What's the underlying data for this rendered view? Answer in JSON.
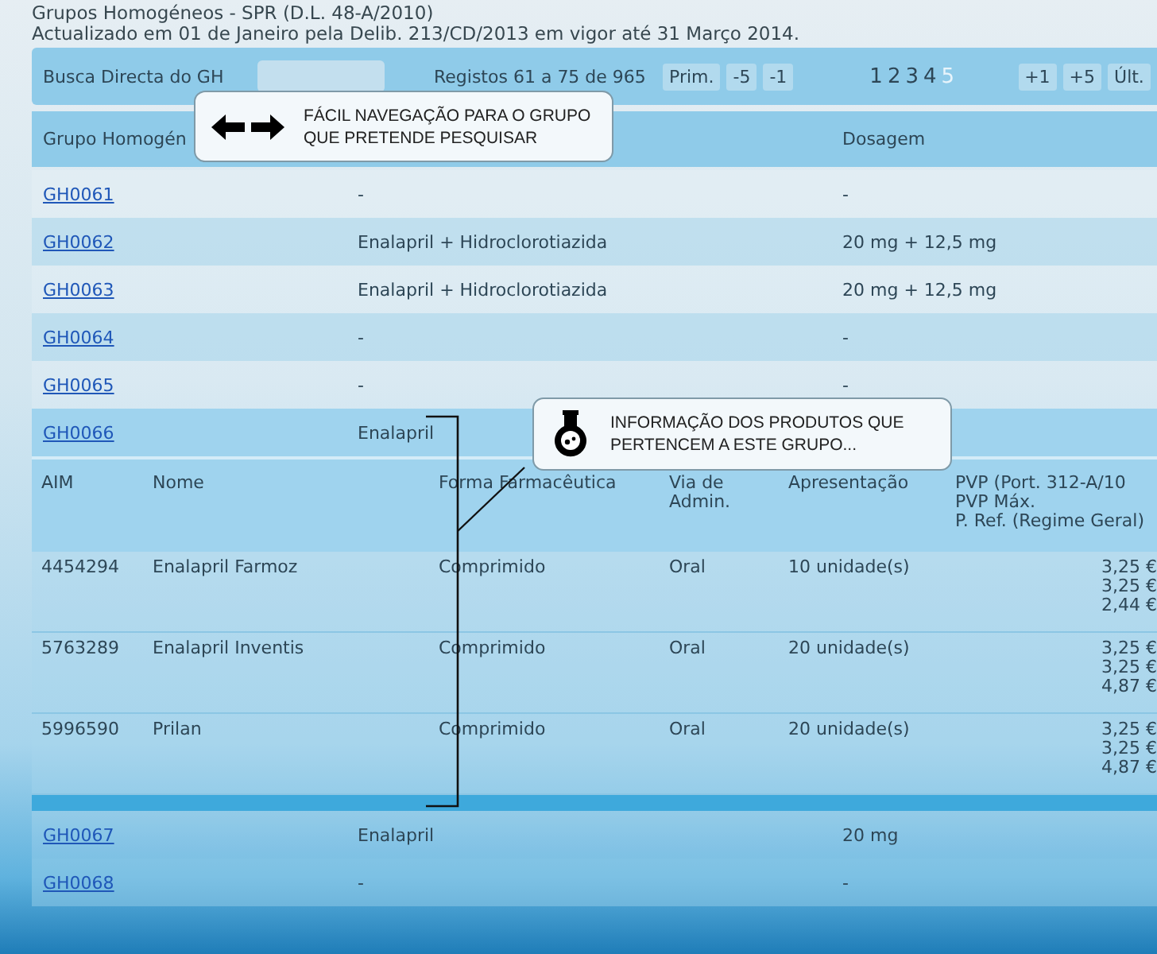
{
  "header": {
    "title": "Grupos Homogéneos - SPR (D.L. 48-A/2010)",
    "subtitle": "Actualizado em 01 de Janeiro pela Delib. 213/CD/2013 em vigor até 31 Março 2014."
  },
  "navigation": {
    "search_label": "Busca Directa do GH",
    "records": "Registos 61 a 75 de 965",
    "left_buttons": [
      "Prim.",
      "-5",
      "-1"
    ],
    "pages": [
      {
        "label": "1",
        "selected": false
      },
      {
        "label": "2",
        "selected": false
      },
      {
        "label": "3",
        "selected": false
      },
      {
        "label": "4",
        "selected": false
      },
      {
        "label": "5",
        "selected": true
      }
    ],
    "right_buttons": [
      "+1",
      "+5",
      "Últ."
    ]
  },
  "table": {
    "columns": [
      "Grupo Homogén",
      "Dosagem"
    ],
    "rows": [
      {
        "code": "GH0061",
        "substance": "-",
        "dosage": "-",
        "expanded": false
      },
      {
        "code": "GH0062",
        "substance": "Enalapril + Hidroclorotiazida",
        "dosage": "20 mg + 12,5 mg",
        "expanded": false
      },
      {
        "code": "GH0063",
        "substance": "Enalapril + Hidroclorotiazida",
        "dosage": "20 mg + 12,5 mg",
        "expanded": false
      },
      {
        "code": "GH0064",
        "substance": "-",
        "dosage": "-",
        "expanded": false
      },
      {
        "code": "GH0065",
        "substance": "-",
        "dosage": "-",
        "expanded": false
      },
      {
        "code": "GH0066",
        "substance": "Enalapril",
        "expanded": true,
        "products": {
          "columns": [
            "AIM",
            "Nome",
            "Forma Farmacêutica",
            "Via de Admin.",
            "Apresentação",
            "PVP (Port. 312-A/10\nPVP Máx.\nP. Ref. (Regime Geral)"
          ],
          "rows": [
            {
              "aim": "4454294",
              "name": "Enalapril Farmoz",
              "form": "Comprimido",
              "route": "Oral",
              "presentation": "10 unidade(s)",
              "prices": [
                "3,25 €",
                "3,25 €",
                "2,44 €"
              ]
            },
            {
              "aim": "5763289",
              "name": "Enalapril Inventis",
              "form": "Comprimido",
              "route": "Oral",
              "presentation": "20 unidade(s)",
              "prices": [
                "3,25 €",
                "3,25 €",
                "4,87 €"
              ]
            },
            {
              "aim": "5996590",
              "name": "Prilan",
              "form": "Comprimido",
              "route": "Oral",
              "presentation": "20 unidade(s)",
              "prices": [
                "3,25 €",
                "3,25 €",
                "4,87 €"
              ]
            }
          ]
        }
      },
      {
        "code": "GH0067",
        "substance": "Enalapril",
        "dosage": "20 mg",
        "expanded": false
      },
      {
        "code": "GH0068",
        "substance": "-",
        "dosage": "-",
        "expanded": false
      }
    ]
  },
  "callouts": [
    {
      "kind": "arrows",
      "text": "FÁCIL NAVEGAÇÃO PARA O GRUPO\nQUE PRETENDE PESQUISAR"
    },
    {
      "kind": "flask",
      "text": "INFORMAÇÃO DOS PRODUTOS QUE\nPERTENCEM A ESTE GRUPO..."
    }
  ]
}
